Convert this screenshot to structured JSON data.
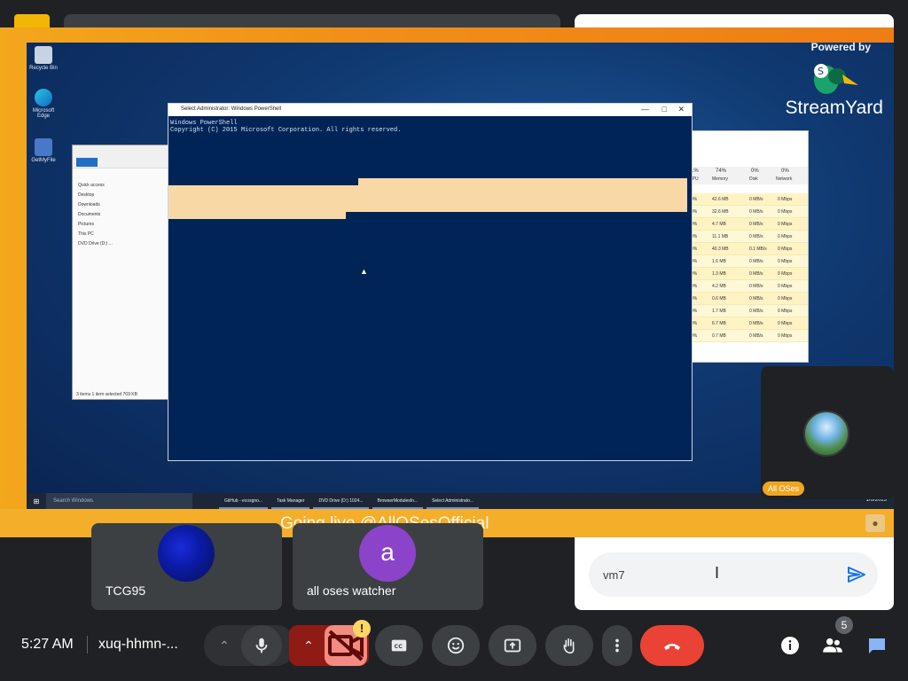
{
  "meeting": {
    "time": "5:27 AM",
    "code": "xuq-hhmn-..."
  },
  "stage": {
    "footer_text": "Going live @AllOSesOfficial",
    "powered_by": "Powered by",
    "brand": "StreamYard"
  },
  "desktop": {
    "icons": [
      {
        "label": "Recycle Bin"
      },
      {
        "label": "Microsoft Edge"
      },
      {
        "label": "GetMyFile"
      }
    ],
    "explorer": {
      "nav": [
        "Quick access",
        "Desktop",
        "Downloads",
        "Documents",
        "Pictures",
        "This PC",
        "DVD Drive (D:) ..."
      ],
      "status": "3 items   1 item selected  769 KB"
    },
    "powershell": {
      "title": "Select Administrator: Windows PowerShell",
      "line1": "Windows PowerShell",
      "line2": "Copyright (C) 2015 Microsoft Corporation. All rights reserved."
    },
    "taskmgr": {
      "headers": [
        "1%",
        "74%",
        "0%",
        "0%"
      ],
      "subheaders": [
        "CPU",
        "Memory",
        "Disk",
        "Network"
      ],
      "rows": [
        [
          "0%",
          "42.6 MB",
          "0 MB/s",
          "0 Mbps"
        ],
        [
          "0%",
          "32.6 MB",
          "0 MB/s",
          "0 Mbps"
        ],
        [
          "0%",
          "4.7 MB",
          "0 MB/s",
          "0 Mbps"
        ],
        [
          "0%",
          "11.1 MB",
          "0 MB/s",
          "0 Mbps"
        ],
        [
          "0%",
          "40.3 MB",
          "0.1 MB/s",
          "0 Mbps"
        ],
        [
          "0%",
          "1.6 MB",
          "0 MB/s",
          "0 Mbps"
        ],
        [
          "0%",
          "1.3 MB",
          "0 MB/s",
          "0 Mbps"
        ],
        [
          "0%",
          "4.2 MB",
          "0 MB/s",
          "0 Mbps"
        ],
        [
          "0%",
          "0.6 MB",
          "0 MB/s",
          "0 Mbps"
        ],
        [
          "0%",
          "1.7 MB",
          "0 MB/s",
          "0 Mbps"
        ],
        [
          "0%",
          "6.7 MB",
          "0 MB/s",
          "0 Mbps"
        ],
        [
          "0%",
          "0.7 MB",
          "0 MB/s",
          "0 Mbps"
        ]
      ]
    },
    "taskbar": {
      "search": "Search Windows",
      "items": [
        "GitHub - ecosgno...",
        "Task Manager",
        "DVD Drive (D:) 1024...",
        "BrowserModulesIn...",
        "Select Administrato..."
      ],
      "tray_date": "1/6/2023"
    }
  },
  "self_tile": {
    "name": "All OSes"
  },
  "participants": [
    {
      "name": "TCG95",
      "avatar": "image"
    },
    {
      "name": "all oses watcher",
      "avatar_letter": "a"
    }
  ],
  "chat": {
    "input_value": "vm7"
  },
  "controls": {
    "camera_alert": "!",
    "people_count": "5"
  },
  "colors": {
    "hangup": "#ea4335",
    "camera_off": "#f28b82",
    "accent_orange": "#f0a621",
    "avatar_purple": "#8b44c9",
    "send_blue": "#1a73e8"
  }
}
